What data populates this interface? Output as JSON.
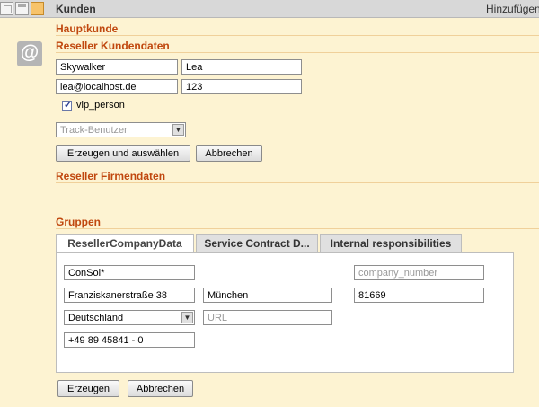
{
  "header": {
    "title": "Kunden",
    "add_link": "Hinzufügen"
  },
  "sections": {
    "main_customer": "Hauptkunde",
    "reseller_customer_data": "Reseller Kundendaten",
    "reseller_company_data": "Reseller Firmendaten",
    "groups": "Gruppen"
  },
  "customer": {
    "last_name": "Skywalker",
    "first_name": "Lea",
    "email": "lea@localhost.de",
    "number": "123",
    "vip_label": "vip_person",
    "vip_checked": true,
    "track_user_placeholder": "Track-Benutzer",
    "create_select_label": "Erzeugen und auswählen",
    "cancel_label": "Abbrechen"
  },
  "tabs": [
    {
      "label": "ResellerCompanyData",
      "active": true
    },
    {
      "label": "Service Contract D...",
      "active": false
    },
    {
      "label": "Internal responsibilities",
      "active": false
    }
  ],
  "company": {
    "name": "ConSol*",
    "company_number_placeholder": "company_number",
    "street": "Franziskanerstraße 38",
    "city": "München",
    "zip": "81669",
    "country": "Deutschland",
    "url_placeholder": "URL",
    "phone": "+49 89 45841 - 0"
  },
  "footer": {
    "create_label": "Erzeugen",
    "cancel_label": "Abbrechen"
  },
  "colors": {
    "background": "#fdf3d2",
    "section_title": "#c0470e",
    "header_bg": "#d8d8d8"
  },
  "icons": {
    "avatar": "at-sign-icon",
    "select_arrow": "chevron-down-icon"
  }
}
